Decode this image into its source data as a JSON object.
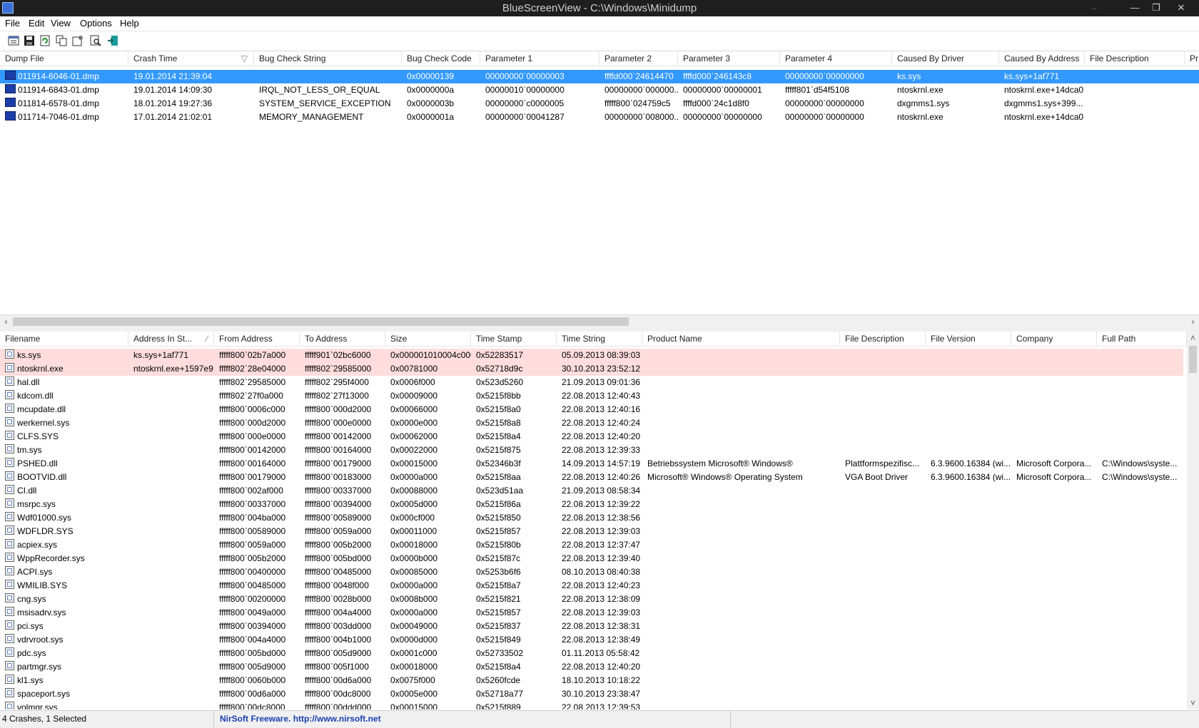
{
  "window": {
    "title": "BlueScreenView  -  C:\\Windows\\Minidump",
    "controls": [
      "⇔",
      "—",
      "❐",
      "✕"
    ]
  },
  "menu": [
    "File",
    "Edit",
    "View",
    "Options",
    "Help"
  ],
  "toolbar": [
    "properties-icon",
    "save-icon",
    "refresh-icon",
    "copy-icon",
    "options-icon",
    "find-icon",
    "exit-icon"
  ],
  "top_table": {
    "columns": [
      "Dump File",
      "Crash Time",
      "Bug Check String",
      "Bug Check Code",
      "Parameter 1",
      "Parameter 2",
      "Parameter 3",
      "Parameter 4",
      "Caused By Driver",
      "Caused By Address",
      "File Description",
      "Pr"
    ],
    "sort_indicator": "▽",
    "rows": [
      [
        "011914-6046-01.dmp",
        "19.01.2014 21:39:04",
        "",
        "0x00000139",
        "00000000`00000003",
        "ffffd000`24614470",
        "ffffd000`246143c8",
        "00000000`00000000",
        "ks.sys",
        "ks.sys+1af771",
        "",
        ""
      ],
      [
        "011914-6843-01.dmp",
        "19.01.2014 14:09:30",
        "IRQL_NOT_LESS_OR_EQUAL",
        "0x0000000a",
        "00000010`00000000",
        "00000000`000000...",
        "00000000`00000001",
        "fffff801`d54f5108",
        "ntoskrnl.exe",
        "ntoskrnl.exe+14dca0",
        "",
        ""
      ],
      [
        "011814-6578-01.dmp",
        "18.01.2014 19:27:36",
        "SYSTEM_SERVICE_EXCEPTION",
        "0x0000003b",
        "00000000`c0000005",
        "fffff800`024759c5",
        "ffffd000`24c1d8f0",
        "00000000`00000000",
        "dxgmms1.sys",
        "dxgmms1.sys+399...",
        "",
        ""
      ],
      [
        "011714-7046-01.dmp",
        "17.01.2014 21:02:01",
        "MEMORY_MANAGEMENT",
        "0x0000001a",
        "00000000`00041287",
        "00000000`008000...",
        "00000000`00000000",
        "00000000`00000000",
        "ntoskrnl.exe",
        "ntoskrnl.exe+14dca0",
        "",
        ""
      ]
    ],
    "selected_row": 0
  },
  "bottom_table": {
    "columns": [
      "Filename",
      "Address In St...",
      "From Address",
      "To Address",
      "Size",
      "Time Stamp",
      "Time String",
      "Product Name",
      "File Description",
      "File Version",
      "Company",
      "Full Path"
    ],
    "sort_indicator": "∕",
    "rows": [
      [
        "ks.sys",
        "ks.sys+1af771",
        "fffff800`02b7a000",
        "fffff901`02bc6000",
        "0x000001010004c000",
        "0x52283517",
        "05.09.2013 08:39:03",
        "",
        "",
        "",
        "",
        ""
      ],
      [
        "ntoskrnl.exe",
        "ntoskrnl.exe+1597e9",
        "fffff802`28e04000",
        "fffff802`29585000",
        "0x00781000",
        "0x52718d9c",
        "30.10.2013 23:52:12",
        "",
        "",
        "",
        "",
        ""
      ],
      [
        "hal.dll",
        "",
        "fffff802`29585000",
        "fffff802`295f4000",
        "0x0006f000",
        "0x523d5260",
        "21.09.2013 09:01:36",
        "",
        "",
        "",
        "",
        ""
      ],
      [
        "kdcom.dll",
        "",
        "fffff802`27f0a000",
        "fffff802`27f13000",
        "0x00009000",
        "0x5215f8bb",
        "22.08.2013 12:40:43",
        "",
        "",
        "",
        "",
        ""
      ],
      [
        "mcupdate.dll",
        "",
        "fffff800`0006c000",
        "fffff800`000d2000",
        "0x00066000",
        "0x5215f8a0",
        "22.08.2013 12:40:16",
        "",
        "",
        "",
        "",
        ""
      ],
      [
        "werkernel.sys",
        "",
        "fffff800`000d2000",
        "fffff800`000e0000",
        "0x0000e000",
        "0x5215f8a8",
        "22.08.2013 12:40:24",
        "",
        "",
        "",
        "",
        ""
      ],
      [
        "CLFS.SYS",
        "",
        "fffff800`000e0000",
        "fffff800`00142000",
        "0x00062000",
        "0x5215f8a4",
        "22.08.2013 12:40:20",
        "",
        "",
        "",
        "",
        ""
      ],
      [
        "tm.sys",
        "",
        "fffff800`00142000",
        "fffff800`00164000",
        "0x00022000",
        "0x5215f875",
        "22.08.2013 12:39:33",
        "",
        "",
        "",
        "",
        ""
      ],
      [
        "PSHED.dll",
        "",
        "fffff800`00164000",
        "fffff800`00179000",
        "0x00015000",
        "0x52346b3f",
        "14.09.2013 14:57:19",
        "Betriebssystem Microsoft® Windows®",
        "Plattformspezifisc...",
        "6.3.9600.16384 (wi...",
        "Microsoft Corpora...",
        "C:\\Windows\\syste..."
      ],
      [
        "BOOTVID.dll",
        "",
        "fffff800`00179000",
        "fffff800`00183000",
        "0x0000a000",
        "0x5215f8aa",
        "22.08.2013 12:40:26",
        "Microsoft® Windows® Operating System",
        "VGA Boot Driver",
        "6.3.9600.16384 (wi...",
        "Microsoft Corpora...",
        "C:\\Windows\\syste..."
      ],
      [
        "CI.dll",
        "",
        "fffff800`002af000",
        "fffff800`00337000",
        "0x00088000",
        "0x523d51aa",
        "21.09.2013 08:58:34",
        "",
        "",
        "",
        "",
        ""
      ],
      [
        "msrpc.sys",
        "",
        "fffff800`00337000",
        "fffff800`00394000",
        "0x0005d000",
        "0x5215f86a",
        "22.08.2013 12:39:22",
        "",
        "",
        "",
        "",
        ""
      ],
      [
        "Wdf01000.sys",
        "",
        "fffff800`004ba000",
        "fffff800`00589000",
        "0x000cf000",
        "0x5215f850",
        "22.08.2013 12:38:56",
        "",
        "",
        "",
        "",
        ""
      ],
      [
        "WDFLDR.SYS",
        "",
        "fffff800`00589000",
        "fffff800`0059a000",
        "0x00011000",
        "0x5215f857",
        "22.08.2013 12:39:03",
        "",
        "",
        "",
        "",
        ""
      ],
      [
        "acpiex.sys",
        "",
        "fffff800`0059a000",
        "fffff800`005b2000",
        "0x00018000",
        "0x5215f80b",
        "22.08.2013 12:37:47",
        "",
        "",
        "",
        "",
        ""
      ],
      [
        "WppRecorder.sys",
        "",
        "fffff800`005b2000",
        "fffff800`005bd000",
        "0x0000b000",
        "0x5215f87c",
        "22.08.2013 12:39:40",
        "",
        "",
        "",
        "",
        ""
      ],
      [
        "ACPI.sys",
        "",
        "fffff800`00400000",
        "fffff800`00485000",
        "0x00085000",
        "0x5253b6f6",
        "08.10.2013 08:40:38",
        "",
        "",
        "",
        "",
        ""
      ],
      [
        "WMILIB.SYS",
        "",
        "fffff800`00485000",
        "fffff800`0048f000",
        "0x0000a000",
        "0x5215f8a7",
        "22.08.2013 12:40:23",
        "",
        "",
        "",
        "",
        ""
      ],
      [
        "cng.sys",
        "",
        "fffff800`00200000",
        "fffff800`0028b000",
        "0x0008b000",
        "0x5215f821",
        "22.08.2013 12:38:09",
        "",
        "",
        "",
        "",
        ""
      ],
      [
        "msisadrv.sys",
        "",
        "fffff800`0049a000",
        "fffff800`004a4000",
        "0x0000a000",
        "0x5215f857",
        "22.08.2013 12:39:03",
        "",
        "",
        "",
        "",
        ""
      ],
      [
        "pci.sys",
        "",
        "fffff800`00394000",
        "fffff800`003dd000",
        "0x00049000",
        "0x5215f837",
        "22.08.2013 12:38:31",
        "",
        "",
        "",
        "",
        ""
      ],
      [
        "vdrvroot.sys",
        "",
        "fffff800`004a4000",
        "fffff800`004b1000",
        "0x0000d000",
        "0x5215f849",
        "22.08.2013 12:38:49",
        "",
        "",
        "",
        "",
        ""
      ],
      [
        "pdc.sys",
        "",
        "fffff800`005bd000",
        "fffff800`005d9000",
        "0x0001c000",
        "0x52733502",
        "01.11.2013 05:58:42",
        "",
        "",
        "",
        "",
        ""
      ],
      [
        "partmgr.sys",
        "",
        "fffff800`005d9000",
        "fffff800`005f1000",
        "0x00018000",
        "0x5215f8a4",
        "22.08.2013 12:40:20",
        "",
        "",
        "",
        "",
        ""
      ],
      [
        "kl1.sys",
        "",
        "fffff800`0060b000",
        "fffff800`00d6a000",
        "0x0075f000",
        "0x5260fcde",
        "18.10.2013 10:18:22",
        "",
        "",
        "",
        "",
        ""
      ],
      [
        "spaceport.sys",
        "",
        "fffff800`00d6a000",
        "fffff800`00dc8000",
        "0x0005e000",
        "0x52718a77",
        "30.10.2013 23:38:47",
        "",
        "",
        "",
        "",
        ""
      ],
      [
        "volmgr.sys",
        "",
        "fffff800`00dc8000",
        "fffff800`00ddd000",
        "0x00015000",
        "0x5215f889",
        "22.08.2013 12:39:53",
        "",
        "",
        "",
        "",
        ""
      ]
    ],
    "highlight_rows": [
      0,
      1
    ],
    "highlight_color": "#ffdddd"
  },
  "status": {
    "count": "4 Crashes, 1 Selected",
    "freeware": "NirSoft Freeware.  http://www.nirsoft.net"
  },
  "colors": {
    "selection": "#3399ff",
    "titlebar": "#1e1e1e"
  }
}
